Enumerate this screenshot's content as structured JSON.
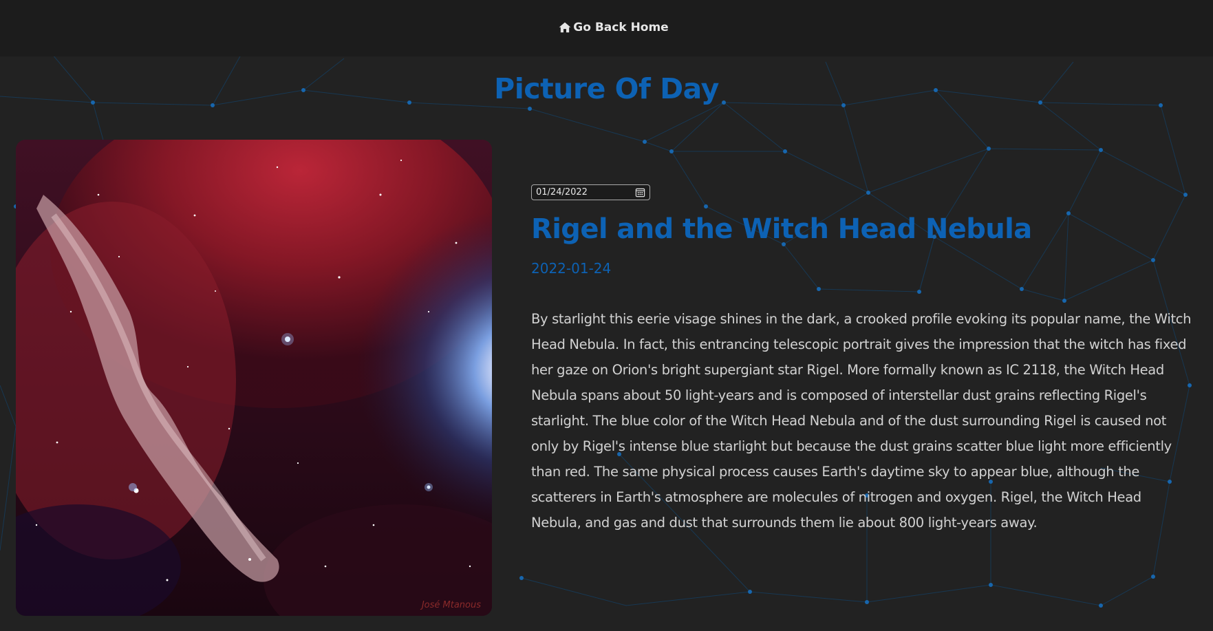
{
  "colors": {
    "background": "#222222",
    "topbar": "#1c1c1c",
    "accent": "#0d62b4",
    "body_text": "#d2d2d2",
    "network": "#0f4a7c"
  },
  "nav": {
    "home_icon": "home-icon",
    "home_label": "Go Back Home"
  },
  "page": {
    "title": "Picture Of Day"
  },
  "apod": {
    "date_value": "01/24/2022",
    "calendar_icon": "calendar-icon",
    "title": "Rigel and the Witch Head Nebula",
    "date": "2022-01-24",
    "image_credit": "José Mtanous",
    "explanation": "By starlight this eerie visage shines in the dark, a crooked profile evoking its popular name, the Witch Head Nebula. In fact, this entrancing telescopic portrait gives the impression that the witch has fixed her gaze on Orion's bright supergiant star Rigel. More formally known as IC 2118, the Witch Head Nebula spans about 50 light-years and is composed of interstellar dust grains reflecting Rigel's starlight. The blue color of the Witch Head Nebula and of the dust surrounding Rigel is caused not only by Rigel's intense blue starlight but because the dust grains scatter blue light more efficiently than red. The same physical process causes Earth's daytime sky to appear blue, although the scatterers in Earth's atmosphere are molecules of nitrogen and oxygen. Rigel, the Witch Head Nebula, and gas and dust that surrounds them lie about 800 light-years away."
  }
}
